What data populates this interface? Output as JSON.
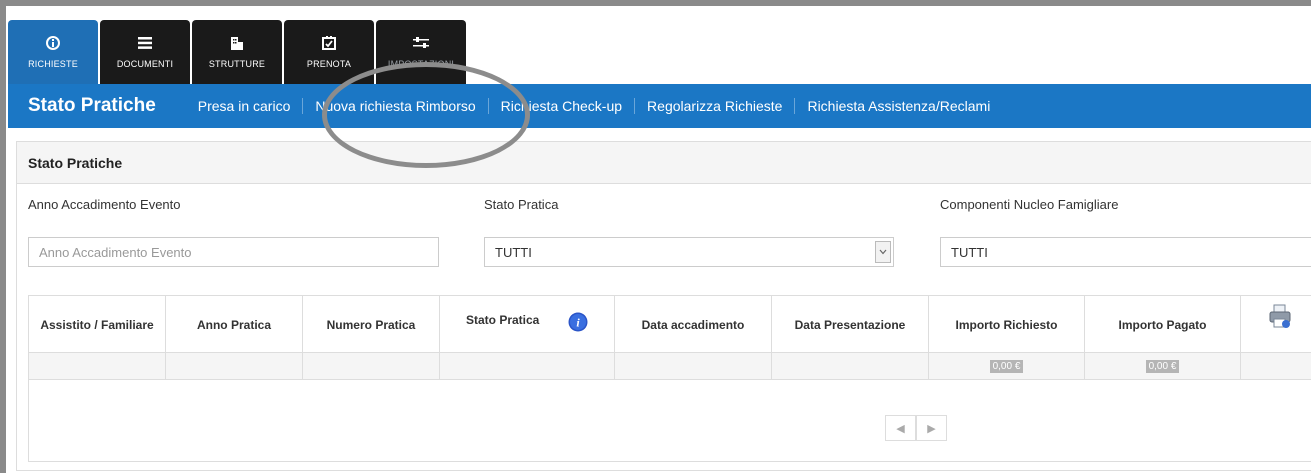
{
  "tabs": [
    {
      "label": "RICHIESTE",
      "icon": "info-icon"
    },
    {
      "label": "DOCUMENTI",
      "icon": "menu-icon"
    },
    {
      "label": "STRUTTURE",
      "icon": "building-icon"
    },
    {
      "label": "PRENOTA",
      "icon": "checklist-icon"
    },
    {
      "label": "IMPOSTAZIONI",
      "icon": "sliders-icon"
    }
  ],
  "bluebar": {
    "brand": "Stato Pratiche",
    "links": [
      "Presa in carico",
      "Nuova richiesta Rimborso",
      "Richiesta Check-up",
      "Regolarizza Richieste",
      "Richiesta Assistenza/Reclami"
    ]
  },
  "panel": {
    "title": "Stato Pratiche",
    "filters": {
      "anno_label": "Anno Accadimento Evento",
      "anno_placeholder": "Anno Accadimento Evento",
      "stato_label": "Stato Pratica",
      "stato_value": "TUTTI",
      "componenti_label": "Componenti Nucleo Famigliare",
      "componenti_value": "TUTTI"
    },
    "table": {
      "headers": [
        "Assistito / Familiare",
        "Anno Pratica",
        "Numero Pratica",
        "Stato Pratica",
        "Data accadimento",
        "Data Presentazione",
        "Importo Richiesto",
        "Importo Pagato"
      ],
      "totals": {
        "richiesto": "0,00 €",
        "pagato": "0,00 €"
      }
    }
  },
  "colors": {
    "accent": "#1b77c5",
    "tab_dark": "#1a1a1a",
    "tab_active": "#1f6fb5"
  }
}
